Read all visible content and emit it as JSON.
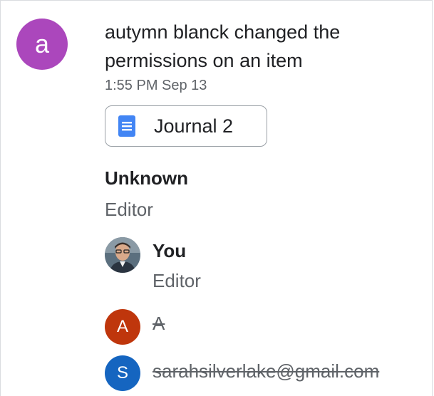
{
  "activity": {
    "actor_initial": "a",
    "headline": "autymn blanck changed the permissions on an item",
    "timestamp": "1:55 PM Sep 13",
    "file": {
      "name": "Journal 2",
      "icon": "google-docs-icon"
    }
  },
  "permissions": {
    "title": "Unknown",
    "role": "Editor",
    "added": [
      {
        "name": "You",
        "role": "Editor",
        "avatar": "user-photo"
      }
    ],
    "removed": [
      {
        "initial": "A",
        "label": "A",
        "color": "#bf360c"
      },
      {
        "initial": "S",
        "label": "sarahsilverlake@gmail.com",
        "color": "#1565c0"
      }
    ]
  },
  "colors": {
    "actor_avatar": "#ab47bc",
    "doc_blue": "#4285f4"
  }
}
